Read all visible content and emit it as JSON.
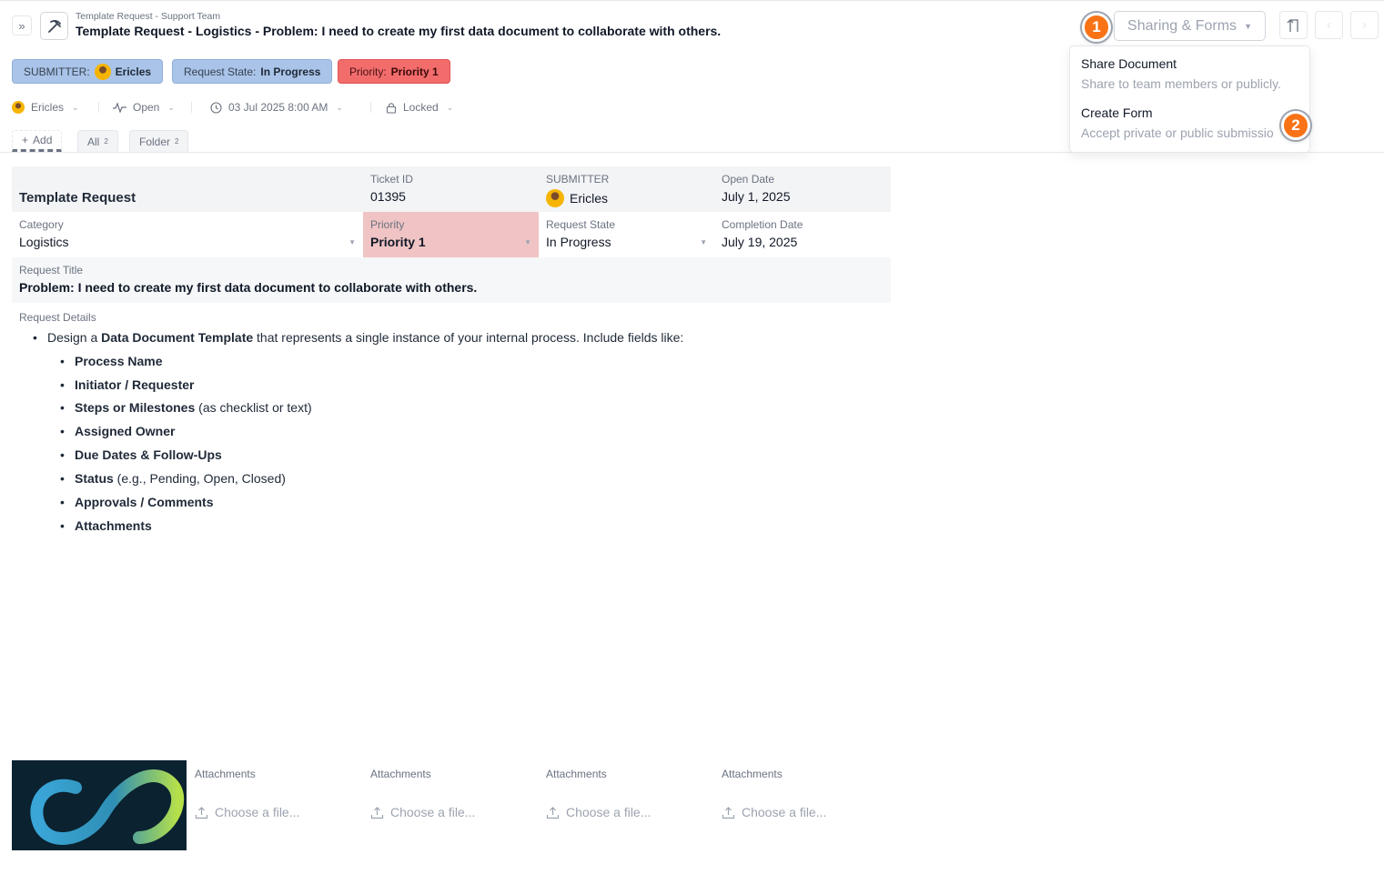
{
  "header": {
    "breadcrumb": "Template Request - Support Team",
    "title": "Template Request - Logistics - Problem: I need to create my first data document to collaborate with others."
  },
  "toolbar": {
    "sharing_label": "Sharing & Forms",
    "marker_1": "1",
    "marker_2": "2"
  },
  "sharing_menu": {
    "items": [
      {
        "title": "Share Document",
        "description": "Share to team members or publicly."
      },
      {
        "title": "Create Form",
        "description": "Accept private or public submissio"
      }
    ]
  },
  "pills": {
    "submitter_label": "SUBMITTER:",
    "submitter_value": "Ericles",
    "state_label": "Request State:",
    "state_value": "In Progress",
    "priority_label": "Priority:",
    "priority_value": "Priority 1"
  },
  "meta": {
    "owner": "Ericles",
    "status": "Open",
    "date": "03 Jul 2025 8:00 AM",
    "lock": "Locked"
  },
  "tabs": [
    {
      "label": "Add",
      "count": ""
    },
    {
      "label": "All",
      "count": "2"
    },
    {
      "label": "Folder",
      "count": "2"
    }
  ],
  "form": {
    "title": "Template Request",
    "ticket_id_label": "Ticket ID",
    "ticket_id": "01395",
    "submitter_label": "SUBMITTER",
    "submitter": "Ericles",
    "open_date_label": "Open Date",
    "open_date": "July 1, 2025",
    "category_label": "Category",
    "category": "Logistics",
    "priority_label": "Priority",
    "priority": "Priority 1",
    "state_label": "Request State",
    "state": "In Progress",
    "completion_label": "Completion Date",
    "completion_date": "July 19, 2025",
    "request_title_label": "Request Title",
    "request_title": "Problem: I need to create my first data document to collaborate with others."
  },
  "details": {
    "label": "Request Details",
    "intro_pre": "Design a ",
    "intro_bold": "Data Document Template",
    "intro_post": " that represents a single instance of your internal process. Include fields like:",
    "items": [
      {
        "bold": "Process Name",
        "rest": ""
      },
      {
        "bold": "Initiator / Requester",
        "rest": ""
      },
      {
        "bold": "Steps or Milestones",
        "rest": " (as checklist or text)"
      },
      {
        "bold": "Assigned Owner",
        "rest": ""
      },
      {
        "bold": "Due Dates & Follow-Ups",
        "rest": ""
      },
      {
        "bold": "Status",
        "rest": " (e.g., Pending, Open, Closed)"
      },
      {
        "bold": "Approvals / Comments",
        "rest": ""
      },
      {
        "bold": "Attachments",
        "rest": ""
      }
    ]
  },
  "attachments": {
    "label": "Attachments",
    "choose": "Choose a file..."
  },
  "colors": {
    "accent_orange": "#f97316",
    "pill_blue": "#a9c4e8",
    "pill_red": "#f26c6c",
    "priority_cell": "#f0c4c4"
  }
}
